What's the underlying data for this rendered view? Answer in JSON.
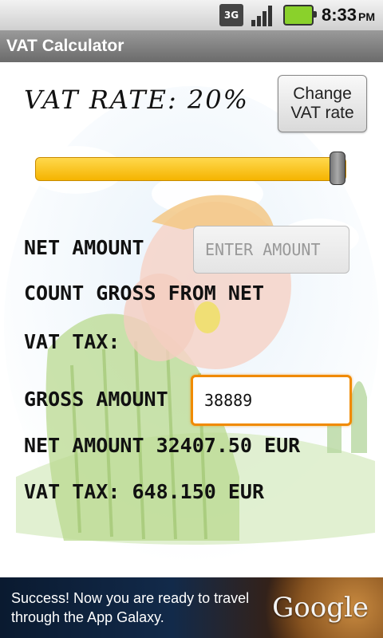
{
  "status_bar": {
    "network": "3G",
    "time": "8:33",
    "ampm": "PM"
  },
  "title_bar": {
    "title": "VAT Calculator"
  },
  "vat": {
    "rate_label": "VAT RATE: 20%",
    "change_button": "Change VAT rate",
    "slider_fraction": 0.99
  },
  "form": {
    "net_amount_label": "NET AMOUNT",
    "net_amount_placeholder": "ENTER AMOUNT",
    "count_gross_label": "COUNT GROSS FROM NET",
    "vat_tax_label": "VAT TAX:",
    "gross_amount_label": "GROSS AMOUNT",
    "gross_amount_value": "38889",
    "result_net": "NET AMOUNT 32407.50 EUR",
    "result_vat": "VAT TAX: 648.150 EUR"
  },
  "ad": {
    "text": "Success! Now you are ready to travel through the App Galaxy.",
    "brand": "Google"
  },
  "colors": {
    "slider": "#f5b400",
    "focus": "#f08a00",
    "title_bar": "#7a7a7a"
  }
}
